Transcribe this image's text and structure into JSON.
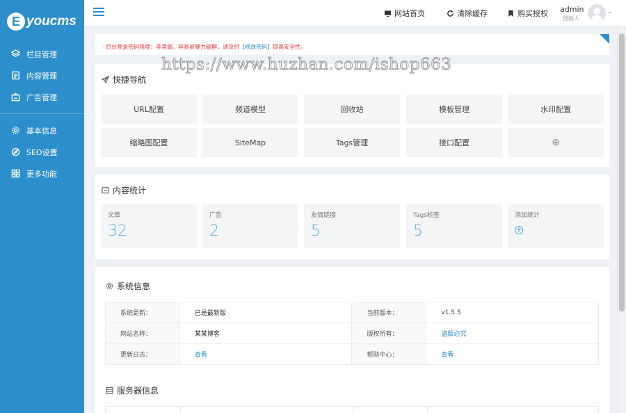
{
  "sidebar": {
    "logo_letter": "E",
    "logo_text": "youcms",
    "items": [
      {
        "label": "栏目管理",
        "icon": "layers-icon"
      },
      {
        "label": "内容管理",
        "icon": "document-icon"
      },
      {
        "label": "广告管理",
        "icon": "ad-icon"
      },
      {
        "label": "基本信息",
        "icon": "gear-icon"
      },
      {
        "label": "SEO设置",
        "icon": "compass-icon"
      },
      {
        "label": "更多功能",
        "icon": "grid-icon"
      }
    ]
  },
  "topbar": {
    "site_home": "网站首页",
    "clear_cache": "清除缓存",
    "buy_license": "购买授权",
    "user_name": "admin",
    "user_role": "创始人"
  },
  "notice": {
    "text_before": "· 后台登录密码强度：非常弱，容易被暴力破解，请及时",
    "link": "【修改密码】",
    "text_after": "提高安全性。"
  },
  "watermark": "https://www.huzhan.com/ishop663",
  "quick_nav": {
    "title": "快捷导航",
    "buttons": [
      "URL配置",
      "频道模型",
      "回收站",
      "模板管理",
      "水印配置",
      "缩略图配置",
      "SiteMap",
      "Tags管理",
      "接口配置"
    ],
    "add_symbol": "⊕"
  },
  "stats": {
    "title": "内容统计",
    "items": [
      {
        "label": "文章",
        "value": "32"
      },
      {
        "label": "广告",
        "value": "2"
      },
      {
        "label": "友情链接",
        "value": "5"
      },
      {
        "label": "Tags标签",
        "value": "5"
      }
    ],
    "add_label": "添加统计",
    "add_symbol": "+"
  },
  "system": {
    "title": "系统信息",
    "rows": [
      {
        "k1": "系统更新：",
        "v1": "已是最新版",
        "k2": "当前版本：",
        "v2": "v1.5.5"
      },
      {
        "k1": "网站名称：",
        "v1": "某某博客",
        "k2": "版权所有：",
        "v2": "盗版必究"
      },
      {
        "k1": "更新日志：",
        "v1": "查看",
        "k2": "帮助中心：",
        "v2": "查看"
      }
    ]
  },
  "server": {
    "title": "服务器信息"
  },
  "colors": {
    "sidebar": "#2c8fcb",
    "accent": "#2c8fcb",
    "warning": "#e4393c",
    "stat_number": "#5bb0e0"
  }
}
